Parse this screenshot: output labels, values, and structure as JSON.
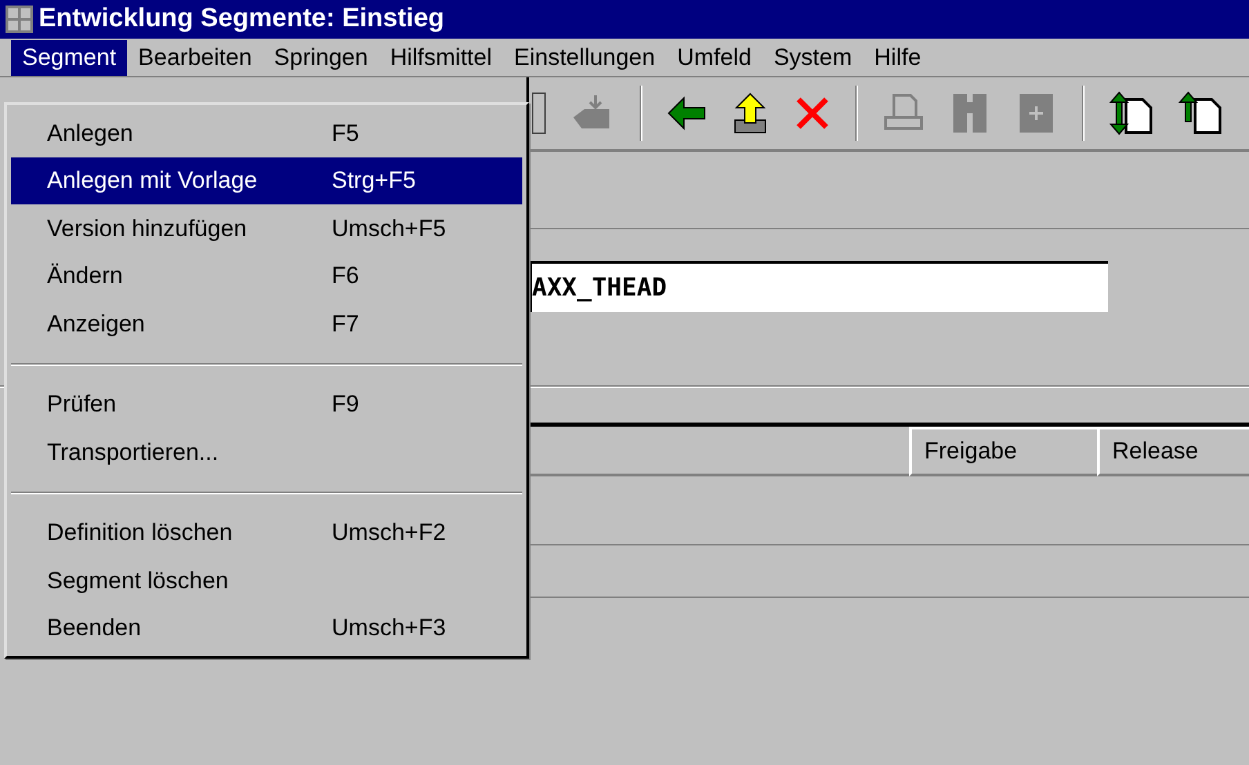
{
  "window": {
    "title": "Entwicklung Segmente: Einstieg"
  },
  "menu_bar": [
    {
      "label": "Segment",
      "selected": true
    },
    {
      "label": "Bearbeiten",
      "selected": false
    },
    {
      "label": "Springen",
      "selected": false
    },
    {
      "label": "Hilfsmittel",
      "selected": false
    },
    {
      "label": "Einstellungen",
      "selected": false
    },
    {
      "label": "Umfeld",
      "selected": false
    },
    {
      "label": "System",
      "selected": false
    },
    {
      "label": "Hilfe",
      "selected": false
    }
  ],
  "dropdown": [
    {
      "kind": "item",
      "label": "Anlegen",
      "shortcut": "F5",
      "selected": false
    },
    {
      "kind": "item",
      "label": "Anlegen mit Vorlage",
      "shortcut": "Strg+F5",
      "selected": true
    },
    {
      "kind": "item",
      "label": "Version hinzufügen",
      "shortcut": "Umsch+F5",
      "selected": false
    },
    {
      "kind": "item",
      "label": "Ändern",
      "shortcut": "F6",
      "selected": false
    },
    {
      "kind": "item",
      "label": "Anzeigen",
      "shortcut": "F7",
      "selected": false
    },
    {
      "kind": "separator"
    },
    {
      "kind": "item",
      "label": "Prüfen",
      "shortcut": "F9",
      "selected": false
    },
    {
      "kind": "item",
      "label": "Transportieren...",
      "selected": false
    },
    {
      "kind": "separator"
    },
    {
      "kind": "item",
      "label": "Definition löschen",
      "shortcut": "Umsch+F2",
      "selected": false
    },
    {
      "kind": "item",
      "label": "Segment löschen",
      "selected": false
    },
    {
      "kind": "item",
      "label": "Beenden",
      "shortcut": "Umsch+F3",
      "selected": false
    }
  ],
  "segment_field": {
    "value": "AXX_THEAD"
  },
  "table": {
    "columns": [
      "Freigabe",
      "Release"
    ]
  }
}
